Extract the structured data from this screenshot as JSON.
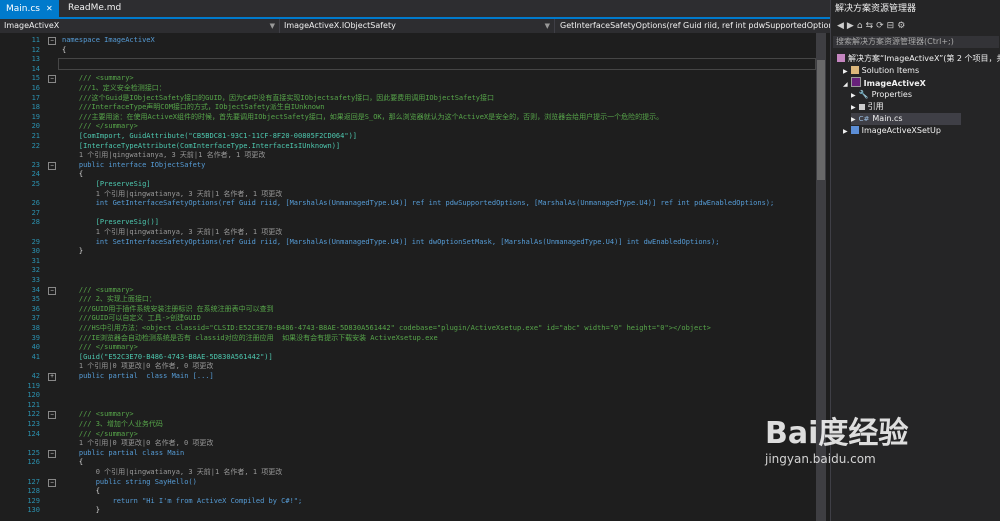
{
  "tabs": [
    {
      "label": "Main.cs"
    },
    {
      "label": "ReadMe.md"
    }
  ],
  "nav": {
    "project": "ImageActiveX",
    "class": "ImageActiveX.IObjectSafety",
    "member": "GetInterfaceSafetyOptions(ref Guid riid, ref int pdwSupportedOptions,"
  },
  "lines": [
    {
      "n": "11",
      "t": "namespace ImageActiveX"
    },
    {
      "n": "12",
      "t": "{"
    },
    {
      "n": "13",
      "t": ""
    },
    {
      "n": "14",
      "t": ""
    },
    {
      "n": "15",
      "t": "    /// <summary>"
    },
    {
      "n": "16",
      "t": "    ///1、定义安全检测接口："
    },
    {
      "n": "17",
      "t": "    ///这个Guid是IObjectSafety接口的GUID，因为C#中没有直接实现IObjectsafety接口，因此要费用调用IObjectSafety接口"
    },
    {
      "n": "18",
      "t": "    ///InterfaceType声明COM接口的方式，IObjectSafety派生自IUnknown"
    },
    {
      "n": "19",
      "t": "    ///主要用途：在使用ActiveX组件的时候，首先要调用IObjectSafety接口，如果返回是S_OK，那么浏览器就认为这个ActiveX是安全的，否则，浏览器会给用户提示一个危险的提示。"
    },
    {
      "n": "20",
      "t": "    /// </summary>"
    },
    {
      "n": "21",
      "t": "    [ComImport, GuidAttribute(\"CB5BDC81-93C1-11CF-8F20-00805F2CD064\")]"
    },
    {
      "n": "22",
      "t": "    [InterfaceTypeAttribute(ComInterfaceType.InterfaceIsIUnknown)]"
    },
    {
      "n": "",
      "t": "    1 个引用|qingwatianya, 3 天前|1 名作者, 1 项更改"
    },
    {
      "n": "23",
      "t": "    public interface IObjectSafety"
    },
    {
      "n": "24",
      "t": "    {"
    },
    {
      "n": "25",
      "t": "        [PreserveSig]"
    },
    {
      "n": "",
      "t": "        1 个引用|qingwatianya, 3 天前|1 名作者, 1 项更改"
    },
    {
      "n": "26",
      "t": "        int GetInterfaceSafetyOptions(ref Guid riid, [MarshalAs(UnmanagedType.U4)] ref int pdwSupportedOptions, [MarshalAs(UnmanagedType.U4)] ref int pdwEnabledOptions);"
    },
    {
      "n": "27",
      "t": ""
    },
    {
      "n": "28",
      "t": "        [PreserveSig()]"
    },
    {
      "n": "",
      "t": "        1 个引用|qingwatianya, 3 天前|1 名作者, 1 项更改"
    },
    {
      "n": "29",
      "t": "        int SetInterfaceSafetyOptions(ref Guid riid, [MarshalAs(UnmanagedType.U4)] int dwOptionSetMask, [MarshalAs(UnmanagedType.U4)] int dwEnabledOptions);"
    },
    {
      "n": "30",
      "t": "    }"
    },
    {
      "n": "31",
      "t": ""
    },
    {
      "n": "32",
      "t": ""
    },
    {
      "n": "33",
      "t": ""
    },
    {
      "n": "34",
      "t": "    /// <summary>"
    },
    {
      "n": "35",
      "t": "    /// 2、实现上面接口："
    },
    {
      "n": "36",
      "t": "    ///GUID用于插件系统安装注册标识 在系统注册表中可以查到"
    },
    {
      "n": "37",
      "t": "    ///GUID可以自定义 工具->创建GUID"
    },
    {
      "n": "38",
      "t": "    ///HS中引用方法：<object classid=\"CLSID:E52C3E70-B486-4743-B8AE-5D830A561442\" codebase=\"plugin/ActiveXsetup.exe\" id=\"abc\" width=\"0\" height=\"0\"></object>"
    },
    {
      "n": "39",
      "t": "    ///IE浏览器会自动检测系统是否有 classid对应的注册应用  如果没有会有提示下载安装 ActiveXsetup.exe"
    },
    {
      "n": "40",
      "t": "    /// </summary>"
    },
    {
      "n": "41",
      "t": "    [Guid(\"E52C3E70-B486-4743-B8AE-5D830A561442\")]"
    },
    {
      "n": "",
      "t": "    1 个引用|0 项更改|0 名作者, 0 项更改"
    },
    {
      "n": "42",
      "t": "    public partial  class Main [...]"
    },
    {
      "n": "119",
      "t": ""
    },
    {
      "n": "120",
      "t": ""
    },
    {
      "n": "121",
      "t": ""
    },
    {
      "n": "122",
      "t": "    /// <summary>"
    },
    {
      "n": "123",
      "t": "    /// 3、增加个人业务代码"
    },
    {
      "n": "124",
      "t": "    /// </summary>"
    },
    {
      "n": "",
      "t": "    1 个引用|0 项更改|0 名作者, 0 项更改"
    },
    {
      "n": "125",
      "t": "    public partial class Main"
    },
    {
      "n": "126",
      "t": "    {"
    },
    {
      "n": "",
      "t": "        0 个引用|qingwatianya, 3 天前|1 名作者, 1 项更改"
    },
    {
      "n": "127",
      "t": "        public string SayHello()"
    },
    {
      "n": "128",
      "t": "        {"
    },
    {
      "n": "129",
      "t": "            return \"Hi I'm from ActiveX Compiled by C#!\";"
    },
    {
      "n": "130",
      "t": "        }"
    }
  ],
  "solution": {
    "title": "解决方案资源管理器",
    "search_placeholder": "搜索解决方案资源管理器(Ctrl+;)",
    "items": [
      {
        "label": "解决方案“ImageActiveX”(第 2 个项目，共 2"
      },
      {
        "label": "Solution Items"
      },
      {
        "label": "ImageActiveX"
      },
      {
        "label": "Properties"
      },
      {
        "label": "引用"
      },
      {
        "label": "Main.cs"
      },
      {
        "label": "ImageActiveXSetUp"
      }
    ]
  },
  "watermark": {
    "brand": "Bai度经验",
    "url": "jingyan.baidu.com"
  }
}
